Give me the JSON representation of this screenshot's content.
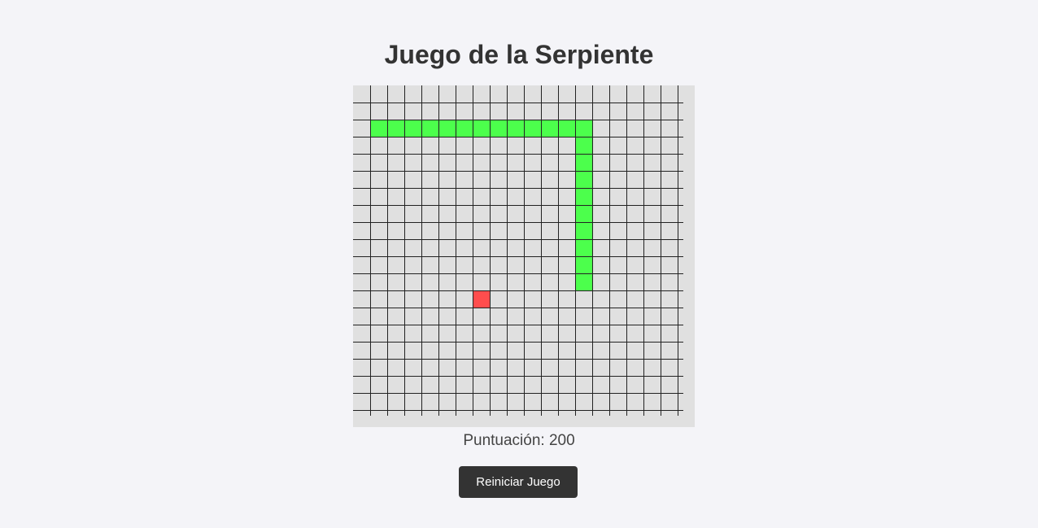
{
  "title": "Juego de la Serpiente",
  "grid": {
    "cols": 20,
    "rows": 20
  },
  "snake": [
    [
      1,
      2
    ],
    [
      2,
      2
    ],
    [
      3,
      2
    ],
    [
      4,
      2
    ],
    [
      5,
      2
    ],
    [
      6,
      2
    ],
    [
      7,
      2
    ],
    [
      8,
      2
    ],
    [
      9,
      2
    ],
    [
      10,
      2
    ],
    [
      11,
      2
    ],
    [
      12,
      2
    ],
    [
      13,
      2
    ],
    [
      13,
      3
    ],
    [
      13,
      4
    ],
    [
      13,
      5
    ],
    [
      13,
      6
    ],
    [
      13,
      7
    ],
    [
      13,
      8
    ],
    [
      13,
      9
    ],
    [
      13,
      10
    ],
    [
      13,
      11
    ]
  ],
  "food": [
    7,
    12
  ],
  "colors": {
    "board": "#e0e0e0",
    "grid_line": "#222222",
    "snake": "#4cff4c",
    "food": "#ff4d4d"
  },
  "score": {
    "label": "Puntuación: 200"
  },
  "restart_label": "Reiniciar Juego"
}
